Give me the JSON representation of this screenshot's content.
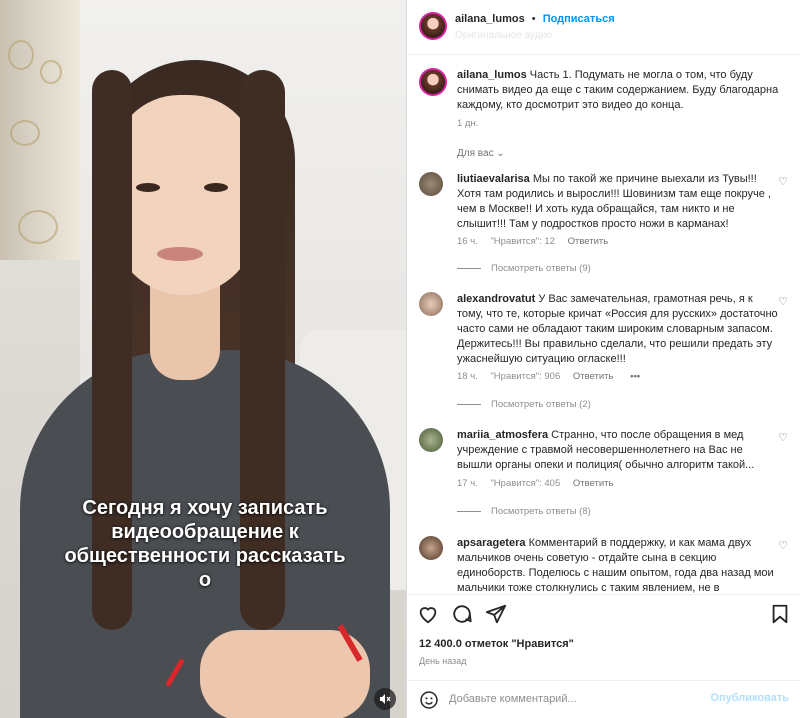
{
  "video": {
    "caption": "Сегодня я хочу записать\nвидеообращение к\nобщественности рассказать\nо",
    "mute_icon": "speaker-muted-icon"
  },
  "header": {
    "username": "ailana_lumos",
    "separator": "•",
    "follow_label": "Подписаться",
    "subtitle": "Оригинальное аудио"
  },
  "caption_post": {
    "username": "ailana_lumos",
    "text": "Часть 1. Подумать не могла о том, что буду снимать видео да еще с таким содержанием. Буду благодарна каждому, кто досмотрит это видео до конца.",
    "time": "1 дн."
  },
  "for_you_label": "Для вас",
  "comments": [
    {
      "username": "liutiaevalarisa",
      "text": "Мы по такой же причине выехали из Тувы!!! Хотя там родились и выросли!!! Шовинизм там еще покруче , чем в Москве!! И хоть куда обращайся, там никто и не слышит!!! Там у подростков просто ножи в карманах!",
      "time": "16 ч.",
      "likes": "\"Нравится\": 12",
      "reply": "Ответить",
      "view_replies": "Посмотреть ответы (9)"
    },
    {
      "username": "alexandrovatut",
      "text": "У Вас замечательная, грамотная речь, я к тому, что те, которые кричат «Россия для русских» достаточно часто сами не обладают таким широким словарным запасом. Держитесь!!! Вы правильно сделали, что решили предать эту ужаснейшую ситуацию огласке!!!",
      "time": "18 ч.",
      "likes": "\"Нравится\": 906",
      "reply": "Ответить",
      "more": "•••",
      "view_replies": "Посмотреть ответы (2)"
    },
    {
      "username": "mariia_atmosfera",
      "text": "Странно, что после обращения в мед учреждение с травмой несовершеннолетнего на Вас не вышли органы опеки и полиция( обычно алгоритм такой...",
      "time": "17 ч.",
      "likes": "\"Нравится\": 405",
      "reply": "Ответить",
      "view_replies": "Посмотреть ответы (8)"
    },
    {
      "username": "apsaragetera",
      "text": "Комментарий в поддержку, и как мама двух мальчиков очень советую - отдайте сына в секцию единоборств. Поделюсь с нашим опытом, года два назад мои мальчики тоже столкнулись с таким явлением, не в"
    }
  ],
  "actions": {
    "like_icon": "heart-icon",
    "comment_icon": "comment-icon",
    "share_icon": "paper-plane-icon",
    "save_icon": "bookmark-icon"
  },
  "likes_text": "12 400.0 отметок \"Нравится\"",
  "date_text": "День назад",
  "add_comment": {
    "placeholder": "Добавьте комментарий...",
    "post_label": "Опубликовать",
    "emoji_icon": "emoji-icon"
  },
  "colors": {
    "link_blue": "#0095f6",
    "post_disabled": "#b2dffc",
    "meta_gray": "#8e8e8e"
  }
}
